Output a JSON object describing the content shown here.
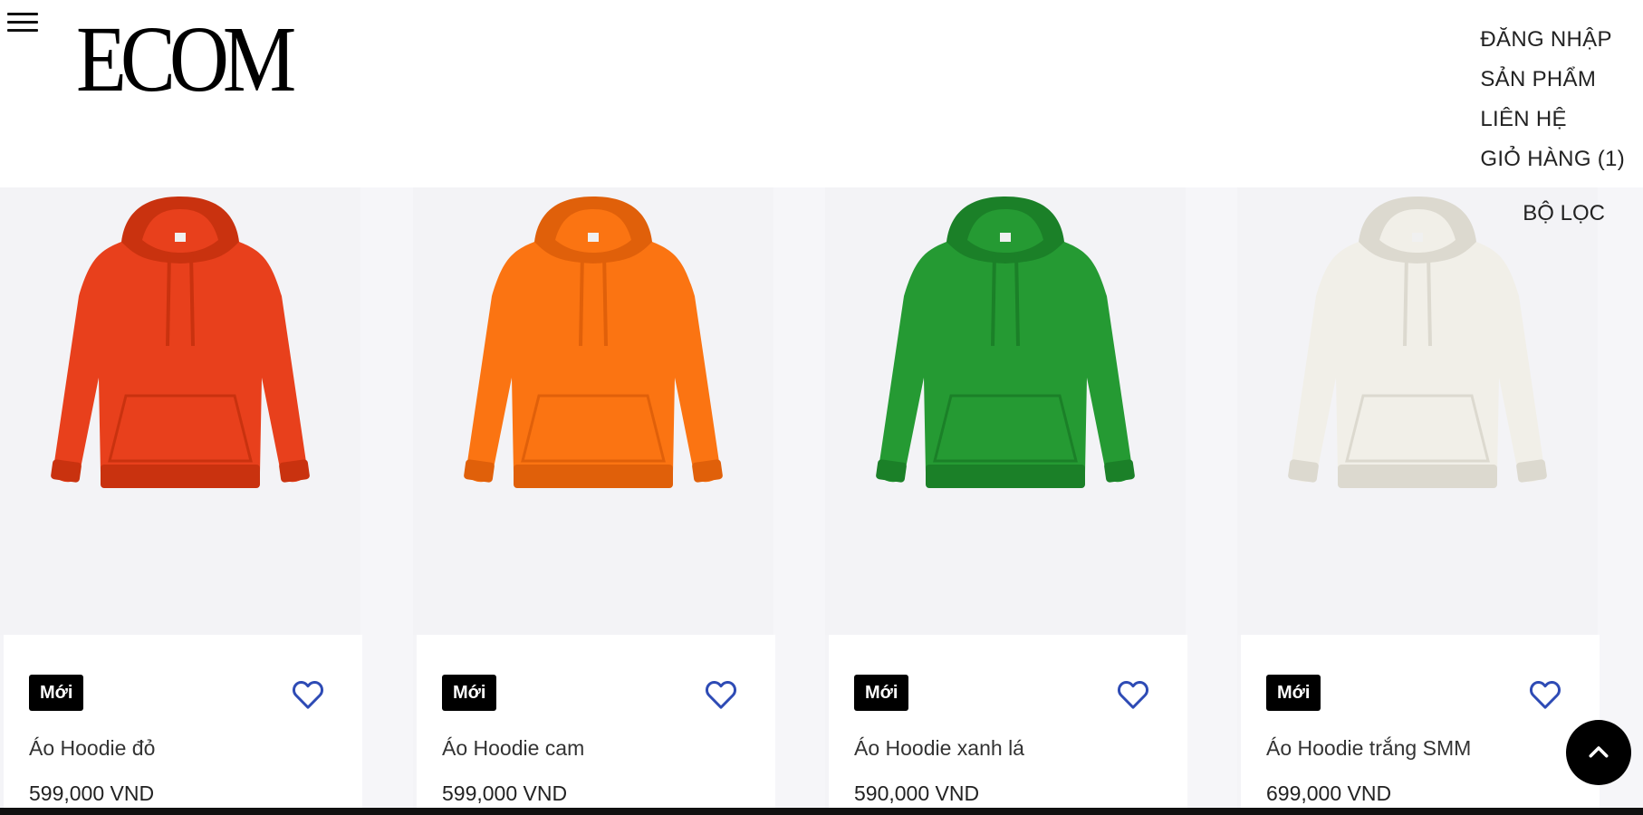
{
  "brand": {
    "logo_text": "ECOM"
  },
  "nav": {
    "login": "ĐĂNG NHẬP",
    "products": "SẢN PHẨM",
    "contact": "LIÊN HỆ",
    "cart": "GIỎ HÀNG (1)"
  },
  "filter": {
    "label": "BỘ LỌC"
  },
  "products": [
    {
      "badge": "Mới",
      "name": "Áo Hoodie đỏ",
      "price": "599,000 VND",
      "color": "#e8401c",
      "shade": "#c9320f",
      "icon": "heart-icon"
    },
    {
      "badge": "Mới",
      "name": "Áo Hoodie cam",
      "price": "599,000 VND",
      "color": "#fb7412",
      "shade": "#e0600a",
      "icon": "heart-icon"
    },
    {
      "badge": "Mới",
      "name": "Áo Hoodie xanh lá",
      "price": "590,000 VND",
      "color": "#259a33",
      "shade": "#1b8028",
      "icon": "heart-icon"
    },
    {
      "badge": "Mới",
      "name": "Áo Hoodie trắng SMM",
      "price": "699,000 VND",
      "color": "#f1efe8",
      "shade": "#dcd9cf",
      "icon": "heart-icon"
    }
  ],
  "colors": {
    "heart_outline": "#2e4bb5",
    "badge_bg": "#000000"
  }
}
